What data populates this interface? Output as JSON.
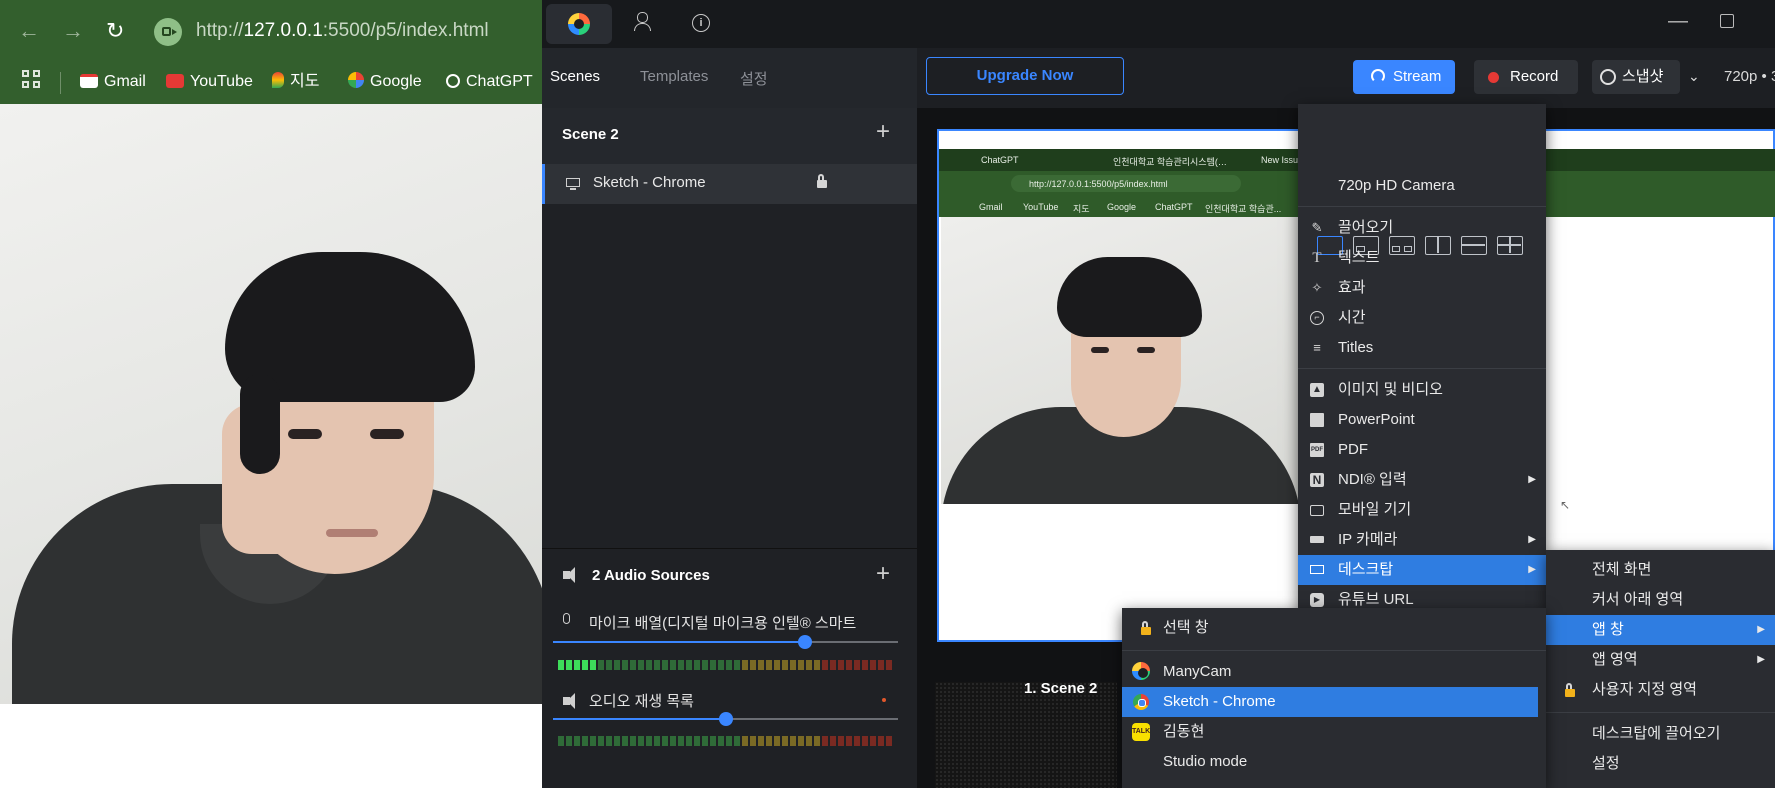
{
  "browser": {
    "url_prefix": "http://",
    "url_host": "127.0.0.1",
    "url_rest": ":5500/p5/index.html",
    "bookmarks": [
      "Gmail",
      "YouTube",
      "지도",
      "Google",
      "ChatGPT"
    ]
  },
  "app": {
    "tabs": [
      "Scenes",
      "Templates",
      "설정"
    ],
    "scene_name": "Scene 2",
    "source_name": "Sketch - Chrome",
    "audio_title": "2 Audio Sources",
    "audio_sources": [
      {
        "label": "마이크 배열(디지털 마이크용 인텔® 스마트",
        "volume": 0.73
      },
      {
        "label": "오디오 재생 목록",
        "volume": 0.5
      }
    ],
    "upgrade_label": "Upgrade Now",
    "stream_label": "Stream",
    "record_label": "Record",
    "snapshot_label": "스냅샷",
    "resolution_label": "720p • 3",
    "scene_thumb_label": "1. Scene 2",
    "mini_browser": {
      "tabs": [
        "ChatGPT",
        "인천대학교 학습관리시스템(…",
        "New Issue"
      ],
      "url": "http://127.0.0.1:5500/p5/index.html",
      "bookmarks": [
        "Gmail",
        "YouTube",
        "지도",
        "Google",
        "ChatGPT",
        "인천대학교 학습관..."
      ]
    }
  },
  "source_menu": {
    "camera": "720p HD Camera",
    "group1": [
      "끌어오기",
      "텍스트",
      "효과",
      "시간",
      "Titles"
    ],
    "group2": [
      "이미지 및 비디오",
      "PowerPoint",
      "PDF",
      "NDI® 입력",
      "모바일 기기",
      "IP 카메라",
      "데스크탑",
      "유튜브 URL"
    ]
  },
  "desktop_menu": {
    "items": [
      "전체 화면",
      "커서 아래 영역",
      "앱 창",
      "앱 영역",
      "사용자 지정 영역",
      "데스크탑에 끌어오기",
      "설정"
    ]
  },
  "app_window_menu": {
    "items": [
      "선택 창",
      "ManyCam",
      "Sketch - Chrome",
      "김동현",
      "Studio mode"
    ]
  },
  "colors": {
    "accent": "#3a86ff",
    "highlight": "#2f7de1",
    "chrome_green": "#335f2d",
    "record_red": "#e53935"
  }
}
